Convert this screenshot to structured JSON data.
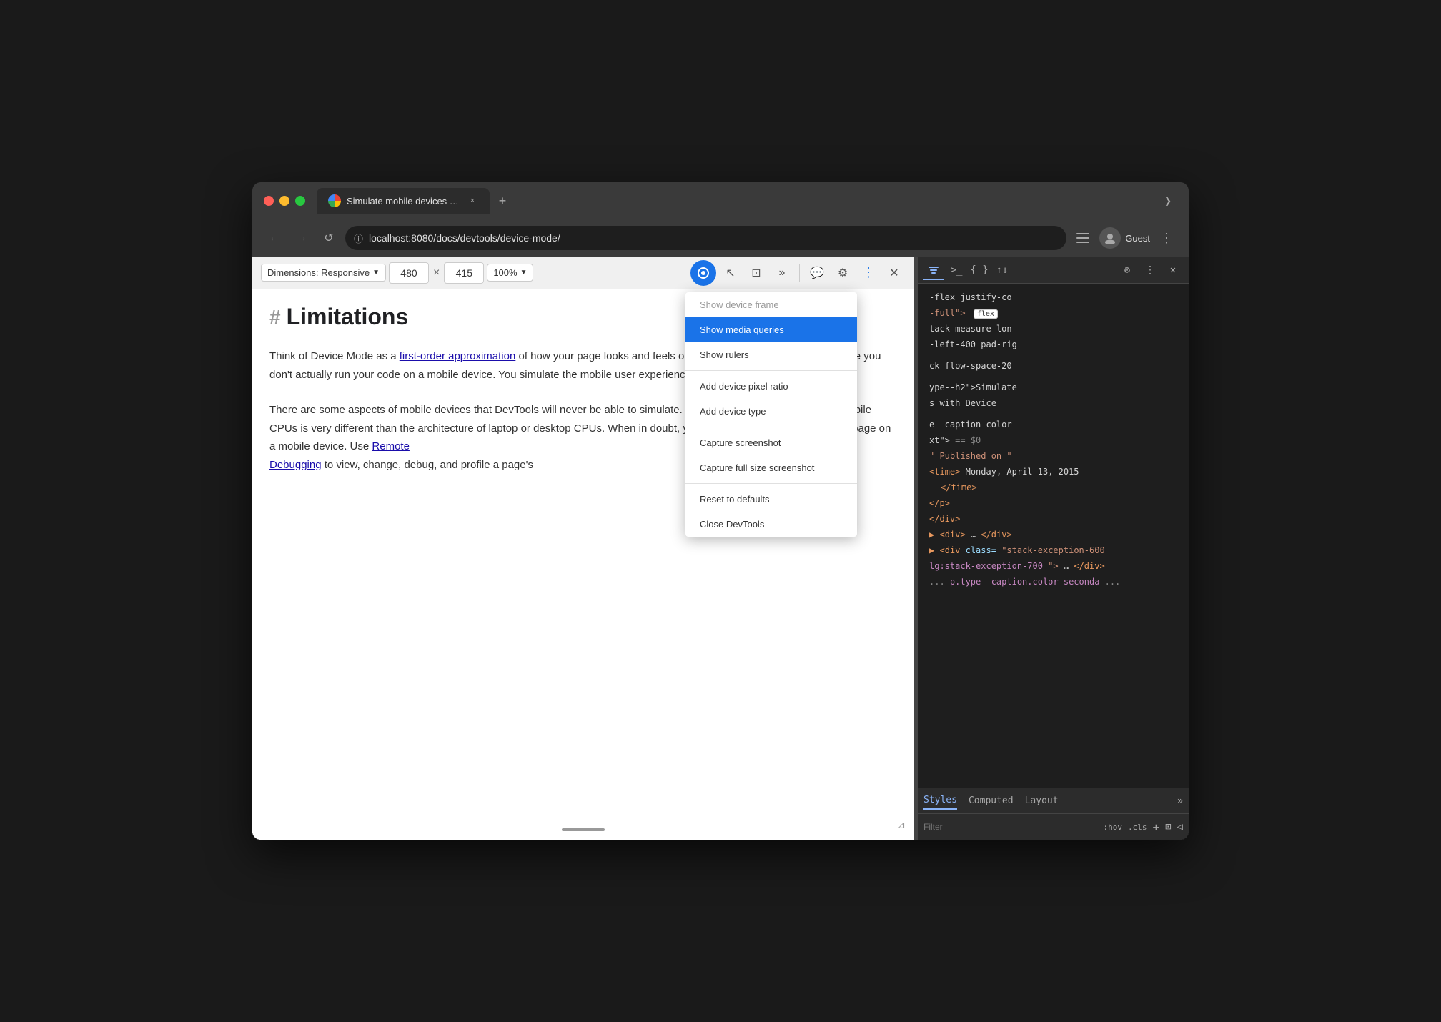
{
  "window": {
    "title": "Simulate mobile devices with D"
  },
  "traffic_lights": {
    "red_label": "close",
    "yellow_label": "minimize",
    "green_label": "maximize"
  },
  "tab": {
    "title": "Simulate mobile devices with D",
    "close_label": "×"
  },
  "new_tab_label": "+",
  "tab_overflow_label": "❯",
  "nav": {
    "back_label": "←",
    "forward_label": "→",
    "reload_label": "↺",
    "url": "localhost:8080/docs/devtools/device-mode/",
    "lock_label": "ⓘ",
    "profile_label": "G",
    "guest_label": "Guest",
    "sidebar_label": "☰",
    "more_label": "⋮"
  },
  "devtools_toolbar": {
    "dimensions_label": "Dimensions: Responsive",
    "width_value": "480",
    "height_value": "415",
    "zoom_label": "100%",
    "separator_label": "×",
    "more_label": "⋮"
  },
  "toolbar_icons": {
    "inspect": "↖",
    "device_toggle": "⊡",
    "overflow": "»",
    "chat": "💬",
    "settings": "⚙",
    "more": "⋮",
    "close": "✕"
  },
  "dropdown_menu": {
    "items": [
      {
        "id": "show-device-frame",
        "label": "Show device frame",
        "enabled": false,
        "highlighted": false
      },
      {
        "id": "show-media-queries",
        "label": "Show media queries",
        "enabled": true,
        "highlighted": true
      },
      {
        "id": "show-rulers",
        "label": "Show rulers",
        "enabled": true,
        "highlighted": false
      },
      {
        "id": "divider1",
        "type": "divider"
      },
      {
        "id": "add-device-pixel-ratio",
        "label": "Add device pixel ratio",
        "enabled": true,
        "highlighted": false
      },
      {
        "id": "add-device-type",
        "label": "Add device type",
        "enabled": true,
        "highlighted": false
      },
      {
        "id": "divider2",
        "type": "divider"
      },
      {
        "id": "capture-screenshot",
        "label": "Capture screenshot",
        "enabled": true,
        "highlighted": false
      },
      {
        "id": "capture-full-size",
        "label": "Capture full size screenshot",
        "enabled": true,
        "highlighted": false
      },
      {
        "id": "divider3",
        "type": "divider"
      },
      {
        "id": "reset-defaults",
        "label": "Reset to defaults",
        "enabled": true,
        "highlighted": false
      },
      {
        "id": "close-devtools",
        "label": "Close DevTools",
        "enabled": true,
        "highlighted": false
      }
    ]
  },
  "page_content": {
    "heading": "Limitations",
    "paragraph1": "Think of Device Mode as a first-order approximation of how your page looks and feels on a mobile device. With Device Mode you don't actually run your code on a mobile device. You simulate the mobile user experience from your laptop or desktop.",
    "link1_text": "first-order approximation",
    "paragraph2": "There are some aspects of mobile devices that DevTools will never be able to simulate. For example, the architecture of mobile CPUs is very different than the architecture of laptop or desktop CPUs. When in doubt, your best bet is to actually run your page on a mobile device. Use Remote Debugging to view, change, debug, and profile a page's",
    "link2_text": "Remote Debugging"
  },
  "html_panel": {
    "lines": [
      {
        "type": "code",
        "content": "-flex justify-co",
        "selected": false
      },
      {
        "type": "code",
        "content": "-full\">",
        "tag": "flex",
        "selected": false
      },
      {
        "type": "code",
        "content": "tack measure-lon",
        "selected": false
      },
      {
        "type": "code",
        "content": "-left-400 pad-rig",
        "selected": false
      },
      {
        "type": "blank",
        "selected": false
      },
      {
        "type": "code",
        "content": "ck flow-space-20",
        "selected": false
      },
      {
        "type": "blank",
        "selected": false
      },
      {
        "type": "code",
        "content": "ype--h2\">Simulate",
        "selected": false
      },
      {
        "type": "code",
        "content": "s with Device",
        "selected": false
      },
      {
        "type": "blank",
        "selected": false
      },
      {
        "type": "code",
        "content": "e--caption color",
        "selected": false
      },
      {
        "type": "code",
        "content": "xt\"> == $0",
        "selected": false
      },
      {
        "type": "text",
        "content": "\" Published on \"",
        "selected": false
      },
      {
        "type": "code",
        "content": "<time>Monday, April 13, 2015",
        "selected": false
      },
      {
        "type": "code",
        "content": "</time>",
        "selected": false
      },
      {
        "type": "code",
        "content": "</p>",
        "selected": false
      },
      {
        "type": "code",
        "content": "</div>",
        "selected": false
      },
      {
        "type": "code",
        "content": "<div>…</div>",
        "selected": false
      },
      {
        "type": "code",
        "content": "<div class=\"stack-exception-600",
        "selected": false
      },
      {
        "type": "code",
        "content": "lg:stack-exception-700\">…</div>",
        "selected": false
      },
      {
        "type": "comment",
        "content": "... p.type--caption.color-seconda ...",
        "selected": false
      }
    ]
  },
  "bottom_tabs": {
    "styles_label": "Styles",
    "computed_label": "Computed",
    "layout_label": "Layout",
    "more_label": "»"
  },
  "filter_bar": {
    "placeholder": "Filter",
    "hov_label": ":hov",
    "cls_label": ".cls",
    "add_label": "+",
    "icon1": "⊡",
    "icon2": "◁"
  }
}
